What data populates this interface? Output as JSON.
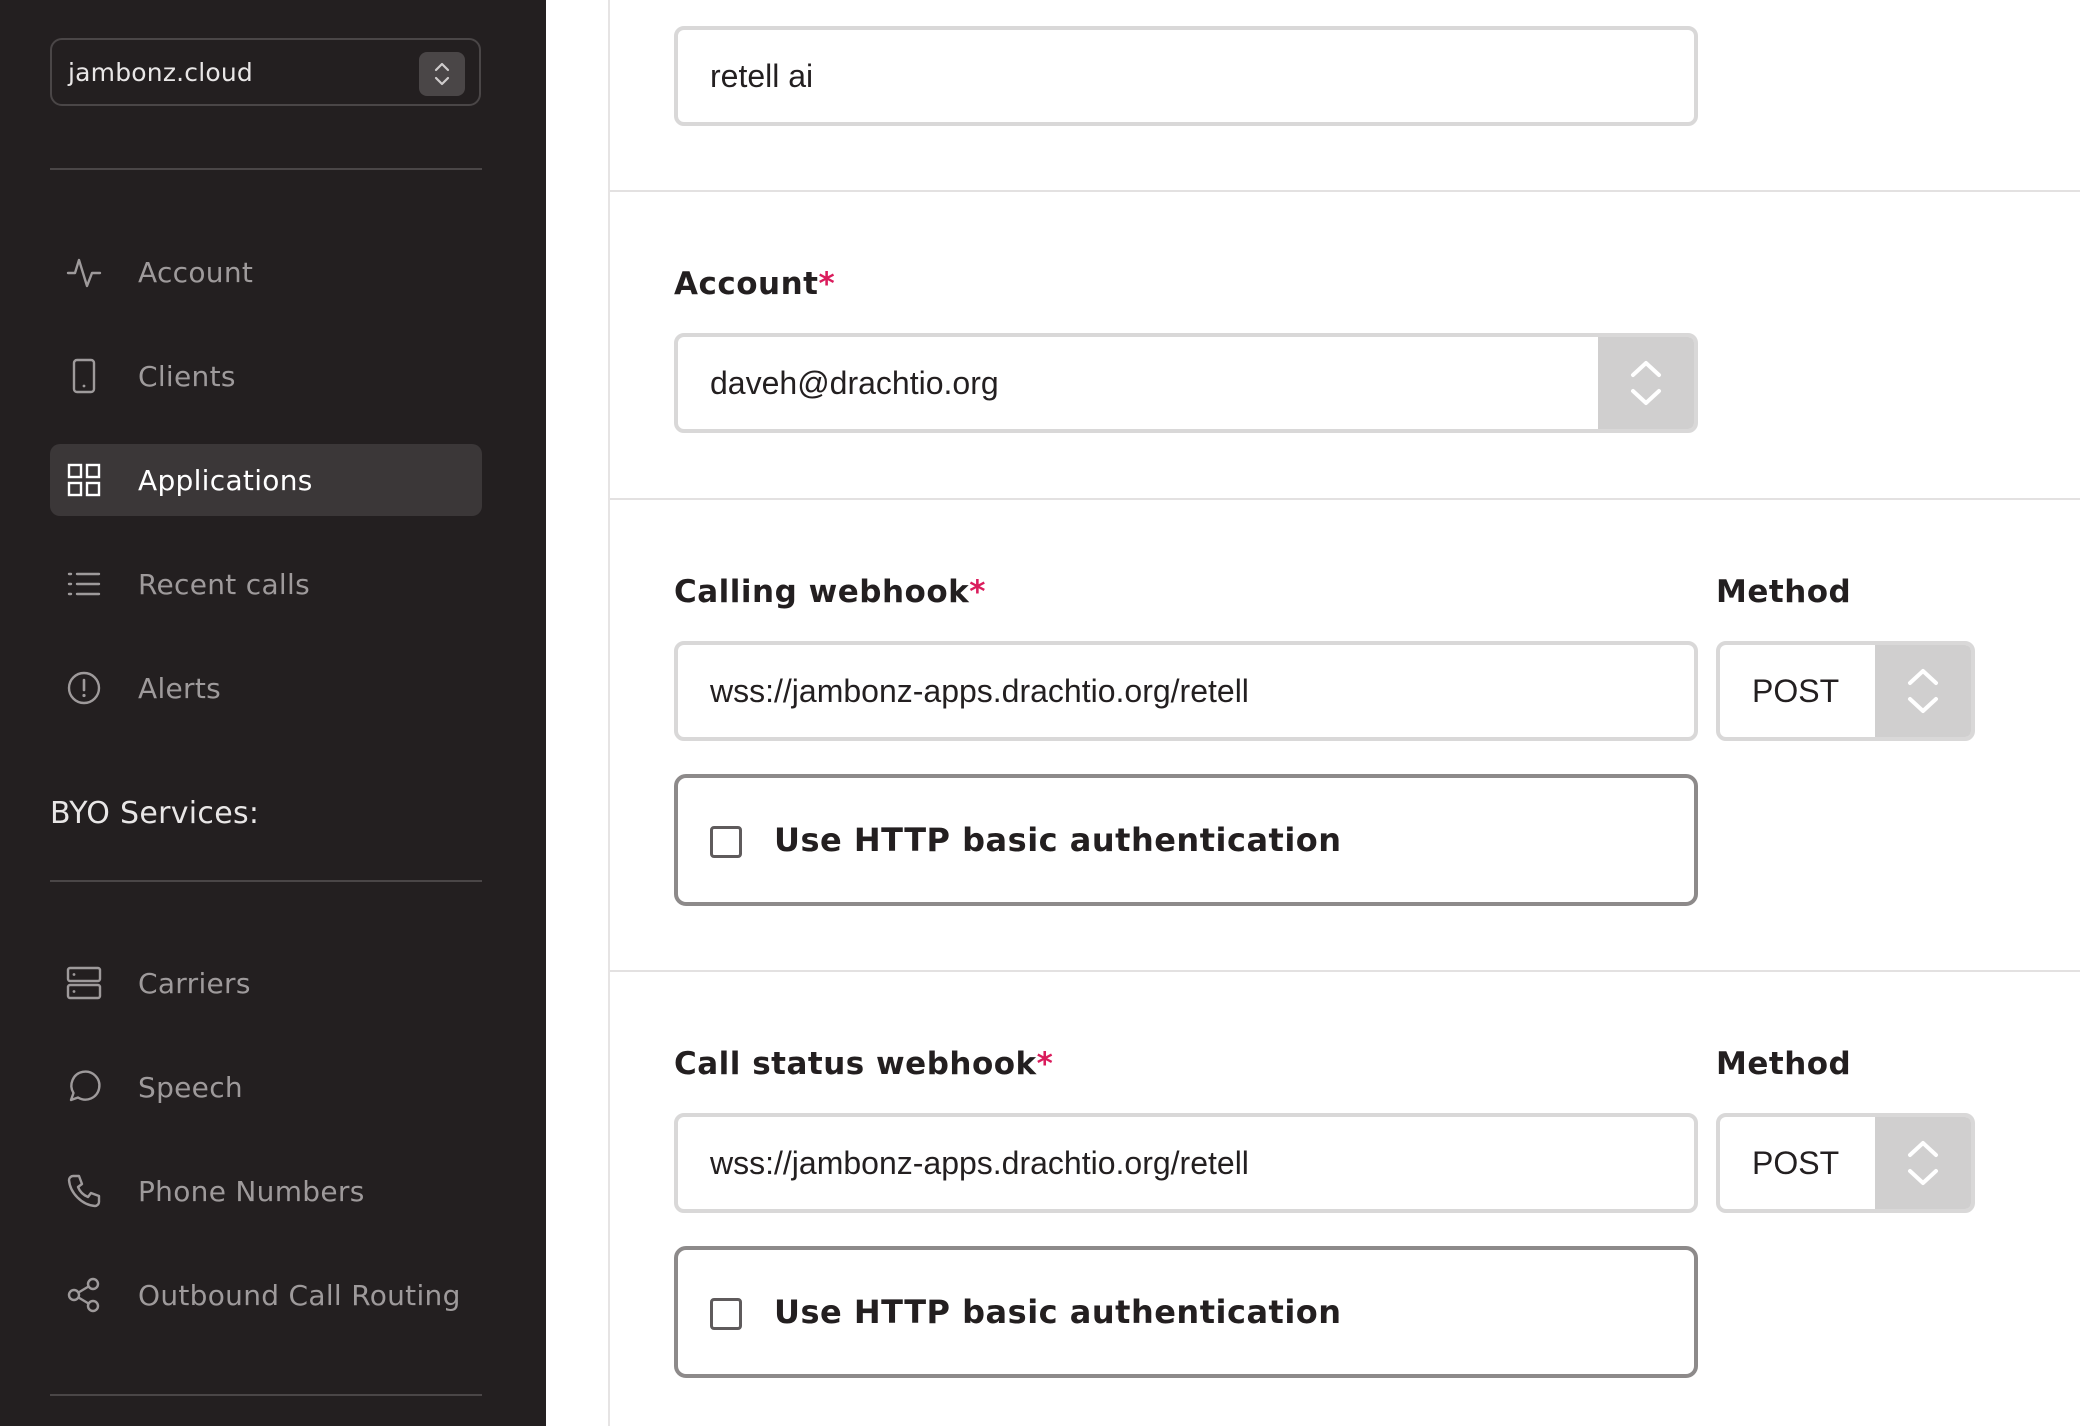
{
  "sidebar": {
    "account_selector": {
      "value": "jambonz.cloud",
      "icon": "chevron-up-down-icon"
    },
    "nav_items": [
      {
        "label": "Account",
        "icon": "activity-icon",
        "active": false
      },
      {
        "label": "Clients",
        "icon": "tablet-icon",
        "active": false
      },
      {
        "label": "Applications",
        "icon": "grid-icon",
        "active": true
      },
      {
        "label": "Recent calls",
        "icon": "list-icon",
        "active": false
      },
      {
        "label": "Alerts",
        "icon": "alert-circle-icon",
        "active": false
      }
    ],
    "byo_heading": "BYO Services:",
    "byo_items": [
      {
        "label": "Carriers",
        "icon": "server-icon"
      },
      {
        "label": "Speech",
        "icon": "message-circle-icon"
      },
      {
        "label": "Phone Numbers",
        "icon": "phone-icon"
      },
      {
        "label": "Outbound Call Routing",
        "icon": "share-icon"
      }
    ]
  },
  "form": {
    "app_name": {
      "value": "retell ai"
    },
    "account": {
      "label": "Account",
      "required_mark": "*",
      "value": "daveh@drachtio.org"
    },
    "calling_webhook": {
      "label": "Calling webhook",
      "required_mark": "*",
      "url": "wss://jambonz-apps.drachtio.org/retell",
      "method_label": "Method",
      "method": "POST",
      "auth_label": "Use HTTP basic authentication",
      "auth_checked": false
    },
    "call_status_webhook": {
      "label": "Call status webhook",
      "required_mark": "*",
      "url": "wss://jambonz-apps.drachtio.org/retell",
      "method_label": "Method",
      "method": "POST",
      "auth_label": "Use HTTP basic authentication",
      "auth_checked": false
    }
  },
  "colors": {
    "sidebar_bg": "#231f20",
    "active_item_bg": "#3b3738",
    "required_accent": "#da1c5c",
    "select_arrow_bg": "#d0cfcf"
  }
}
